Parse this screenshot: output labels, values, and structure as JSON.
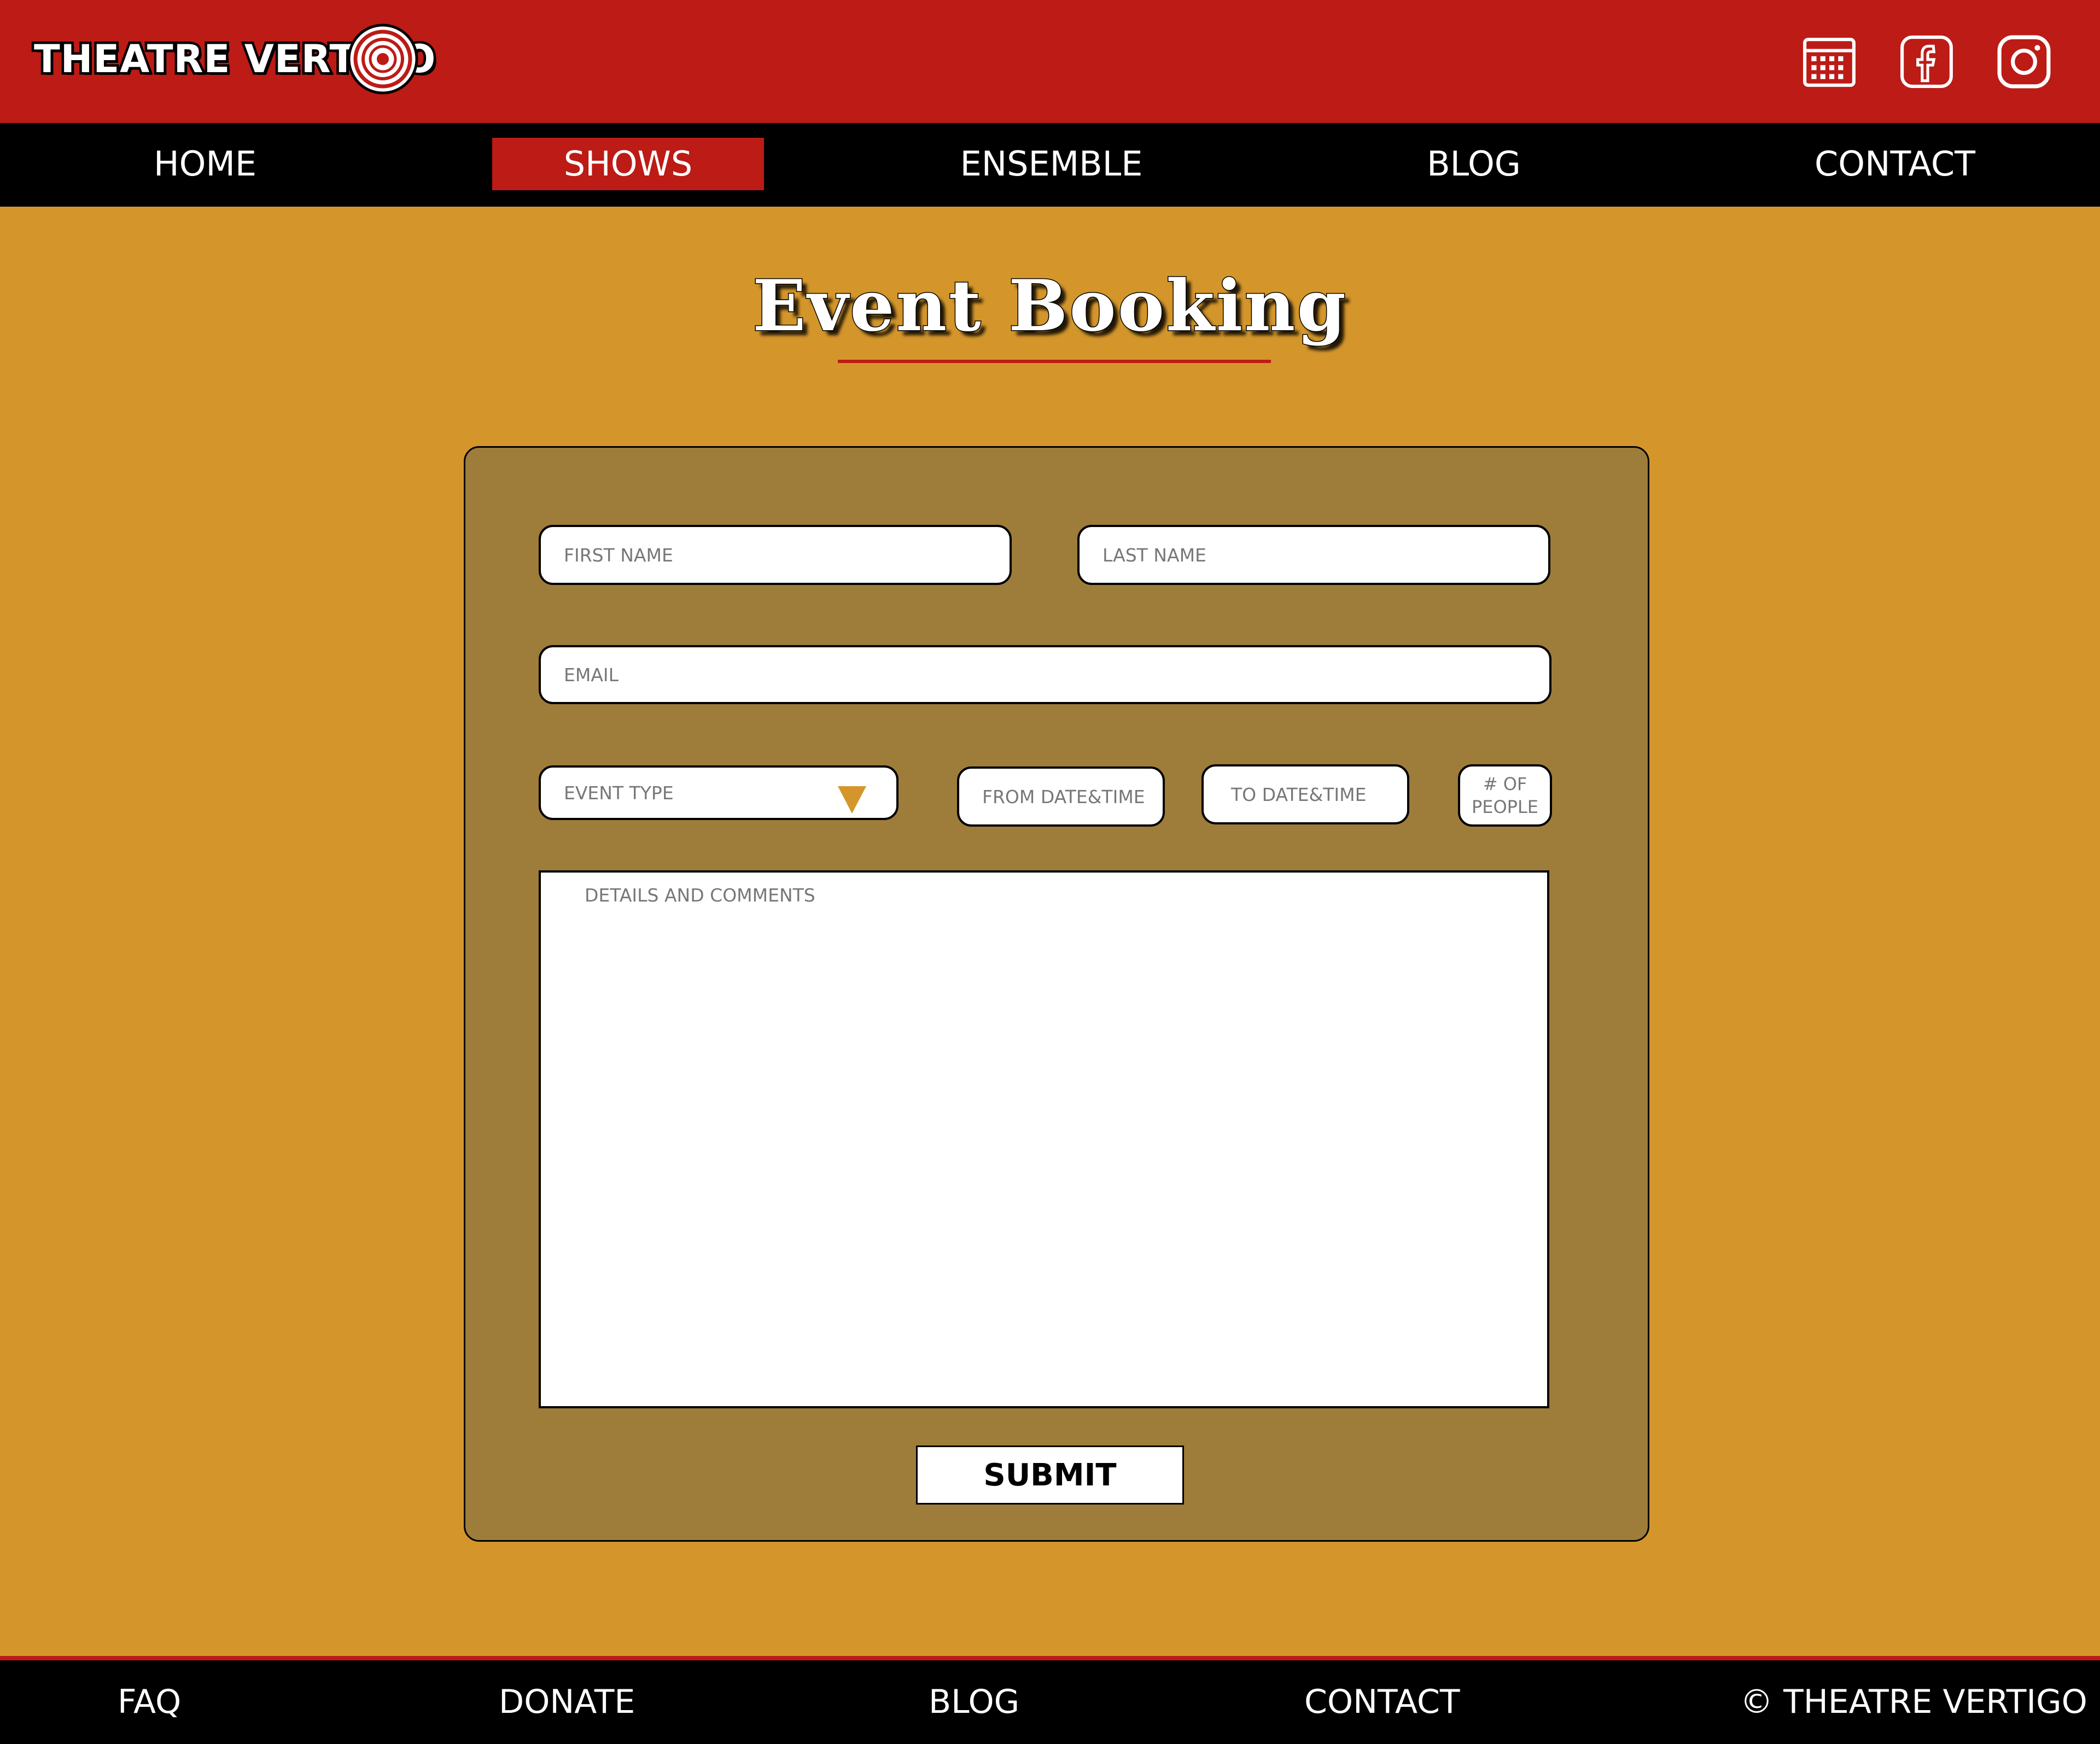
{
  "brand": {
    "name": "THEATRE VERTIGO"
  },
  "header": {
    "icons": [
      "calendar-icon",
      "facebook-icon",
      "instagram-icon"
    ]
  },
  "nav": {
    "items": [
      {
        "label": "HOME",
        "active": false
      },
      {
        "label": "SHOWS",
        "active": true
      },
      {
        "label": "ENSEMBLE",
        "active": false
      },
      {
        "label": "BLOG",
        "active": false
      },
      {
        "label": "CONTACT",
        "active": false
      }
    ]
  },
  "page": {
    "title": "Event Booking"
  },
  "form": {
    "first_name": {
      "placeholder": "FIRST NAME",
      "value": ""
    },
    "last_name": {
      "placeholder": "LAST NAME",
      "value": ""
    },
    "email": {
      "placeholder": "EMAIL",
      "value": ""
    },
    "event_type": {
      "placeholder": "EVENT TYPE",
      "value": ""
    },
    "from_datetime": {
      "placeholder": "FROM DATE&TIME",
      "value": ""
    },
    "to_datetime": {
      "placeholder": "TO DATE&TIME",
      "value": ""
    },
    "people": {
      "placeholder_line1": "# OF",
      "placeholder_line2": "PEOPLE",
      "value": ""
    },
    "details": {
      "placeholder": "DETAILS AND COMMENTS",
      "value": ""
    },
    "submit_label": "SUBMIT"
  },
  "footer": {
    "items": [
      "FAQ",
      "DONATE",
      "BLOG",
      "CONTACT",
      "© THEATRE VERTIGO"
    ]
  },
  "colors": {
    "header_red": "#bc1b16",
    "page_bg": "#d4962b",
    "panel_bg": "#9e7c3a",
    "nav_bg": "#000000"
  }
}
